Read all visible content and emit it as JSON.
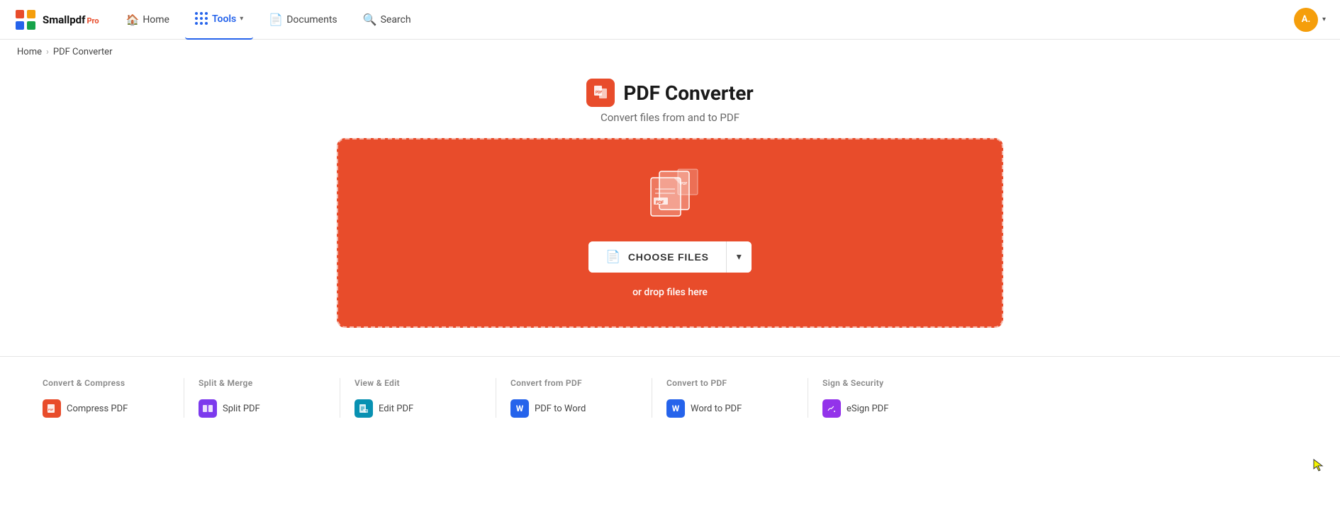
{
  "brand": {
    "name": "Smallpdf",
    "pro_label": "Pro",
    "logo_color": "#e84c2b"
  },
  "navbar": {
    "home_label": "Home",
    "tools_label": "Tools",
    "documents_label": "Documents",
    "search_label": "Search",
    "avatar_initials": "A.",
    "avatar_color": "#f59e0b"
  },
  "breadcrumb": {
    "home": "Home",
    "current": "PDF Converter"
  },
  "page": {
    "title": "PDF Converter",
    "subtitle": "Convert files from and to PDF"
  },
  "dropzone": {
    "choose_files_label": "CHOOSE FILES",
    "drop_text": "or drop files here"
  },
  "tool_categories": [
    {
      "title": "Convert & Compress",
      "items": [
        {
          "label": "Compress PDF",
          "icon_color": "icon-red",
          "icon_char": "⊟"
        }
      ]
    },
    {
      "title": "Split & Merge",
      "items": [
        {
          "label": "Split PDF",
          "icon_color": "icon-purple",
          "icon_char": "⚟"
        }
      ]
    },
    {
      "title": "View & Edit",
      "items": [
        {
          "label": "Edit PDF",
          "icon_color": "icon-teal",
          "icon_char": "✎"
        }
      ]
    },
    {
      "title": "Convert from PDF",
      "items": [
        {
          "label": "PDF to Word",
          "icon_color": "icon-word",
          "icon_char": "W"
        }
      ]
    },
    {
      "title": "Convert to PDF",
      "items": [
        {
          "label": "Word to PDF",
          "icon_color": "icon-word",
          "icon_char": "W"
        }
      ]
    },
    {
      "title": "Sign & Security",
      "items": [
        {
          "label": "eSign PDF",
          "icon_color": "icon-esign",
          "icon_char": "✍"
        }
      ]
    }
  ]
}
